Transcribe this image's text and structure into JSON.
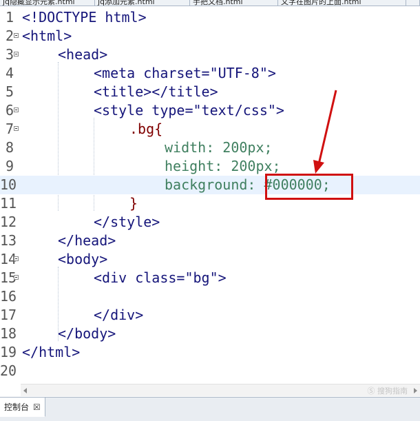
{
  "tabs": [
    {
      "label": "jq隐藏显示元素.html"
    },
    {
      "label": "jq添加元素.html"
    },
    {
      "label": "手把文档.html"
    },
    {
      "label": "文字在图片的上面.html"
    }
  ],
  "editor": {
    "lines": [
      {
        "num": "1",
        "text": "<!DOCTYPE html>"
      },
      {
        "num": "2",
        "text": "<html>"
      },
      {
        "num": "3",
        "text": "<head>"
      },
      {
        "num": "4",
        "text": "<meta charset=\"UTF-8\">"
      },
      {
        "num": "5",
        "text": "<title></title>"
      },
      {
        "num": "6",
        "text": "<style type=\"text/css\">"
      },
      {
        "num": "7",
        "text": ".bg{"
      },
      {
        "num": "8",
        "text": "width: 200px;"
      },
      {
        "num": "9",
        "text": "height: 200px;"
      },
      {
        "num": "10",
        "text": "background: #000000;"
      },
      {
        "num": "11",
        "text": "}"
      },
      {
        "num": "12",
        "text": "</style>"
      },
      {
        "num": "13",
        "text": "</head>"
      },
      {
        "num": "14",
        "text": "<body>"
      },
      {
        "num": "15",
        "text": "<div class=\"bg\">"
      },
      {
        "num": "16",
        "text": ""
      },
      {
        "num": "17",
        "text": "</div>"
      },
      {
        "num": "18",
        "text": "</body>"
      },
      {
        "num": "19",
        "text": "</html>"
      },
      {
        "num": "20",
        "text": ""
      }
    ],
    "current_line": "10"
  },
  "bottom_panel": {
    "console_tab_label": "控制台"
  },
  "watermark": "Ⓢ 搜狗指南",
  "colors": {
    "annotation_red": "#d01010",
    "current_line_bg": "#e8f2fe"
  }
}
